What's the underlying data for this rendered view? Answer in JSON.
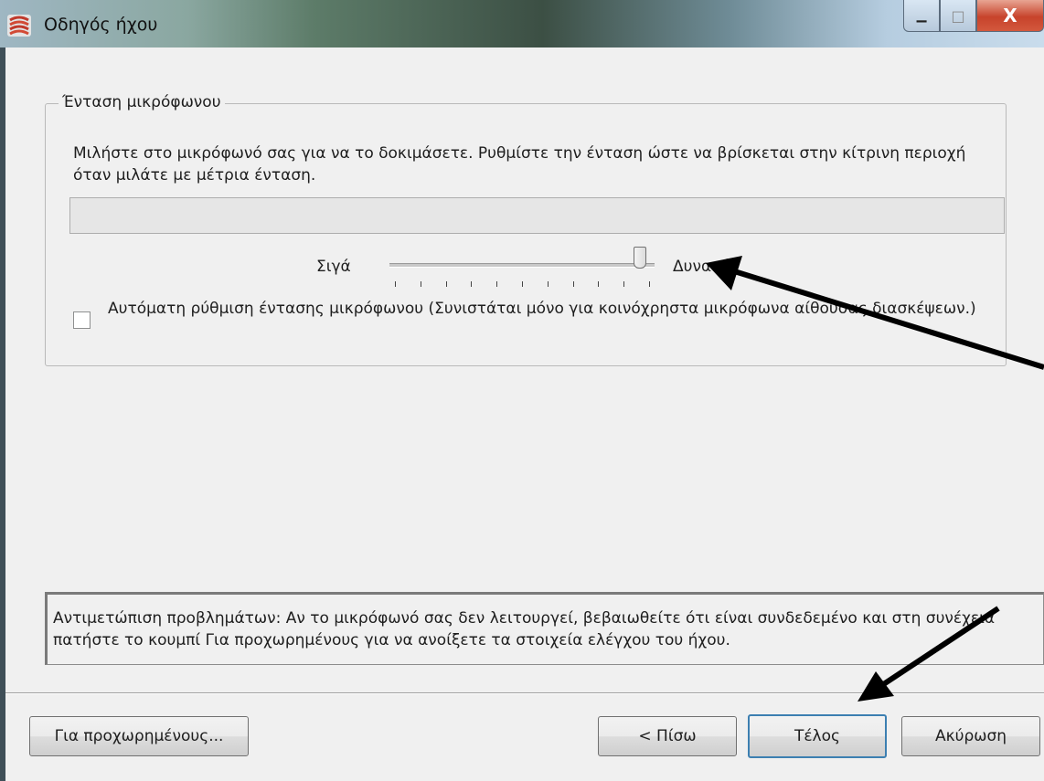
{
  "window": {
    "title": "Οδηγός ήχου",
    "close_glyph": "X",
    "maximize_glyph": "□",
    "minimize_glyph": "▁"
  },
  "mic_group": {
    "legend": "Ένταση μικρόφωνου",
    "instructions": "Μιλήστε στο μικρόφωνό σας για να το δοκιμάσετε. Ρυθμίστε την ένταση ώστε να βρίσκεται στην κίτρινη περιοχή όταν μιλάτε με μέτρια ένταση.",
    "level_meter_value": 0,
    "slider": {
      "min_label": "Σιγά",
      "max_label": "Δυνατά",
      "value_fraction": 0.96,
      "tick_count": 11
    },
    "auto_adjust": {
      "label": "Αυτόματη ρύθμιση έντασης μικρόφωνου (Συνιστάται μόνο για κοινόχρηστα μικρόφωνα αίθουσας διασκέψεων.)",
      "checked": false
    }
  },
  "troubleshooting": {
    "text": "Αντιμετώπιση προβλημάτων: Αν το μικρόφωνό σας δεν λειτουργεί, βεβαιωθείτε ότι είναι συνδεδεμένο και στη συνέχεια πατήστε το κουμπί Για προχωρημένους για να ανοίξετε τα στοιχεία ελέγχου του ήχου."
  },
  "buttons": {
    "advanced": "Για προχωρημένους...",
    "back": "< Πίσω",
    "finish": "Τέλος",
    "cancel": "Ακύρωση"
  },
  "colors": {
    "dialog_bg": "#f0f0f0",
    "default_button_border": "#3c7fb1",
    "annotation_arrow": "#000000"
  }
}
